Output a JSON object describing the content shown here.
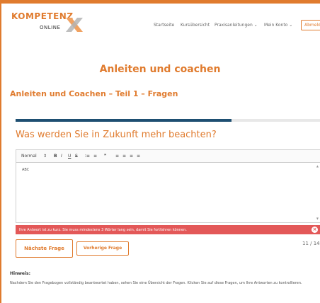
{
  "brand": {
    "name_top": "KOMPETENZ",
    "name_bottom": "ONLINE",
    "icon": "x-mark-logo"
  },
  "nav": {
    "items": [
      {
        "label": "Startseite"
      },
      {
        "label": "Kursübersicht"
      },
      {
        "label": "Praxisanleitungen ⌄"
      },
      {
        "label": "Mein Konto ⌄"
      }
    ],
    "logout_label": "Abmelden"
  },
  "page": {
    "title": "Anleiten und coachen",
    "subtitle": "Anleiten und Coachen – Teil 1 – Fragen"
  },
  "quiz": {
    "progress": 0.71,
    "question": "Was werden Sie in Zukunft mehr beachten?",
    "answer_text": "ABC",
    "counter": "11 / 14"
  },
  "editor_toolbar": {
    "format_select": "Normal",
    "format_arrow": "⇕",
    "bold": "B",
    "italic": "I",
    "underline": "U",
    "strike": "S",
    "ordered_list": "⁝≡",
    "bullet_list": "≡",
    "quote": "❞",
    "align_left": "≡",
    "align_center": "≡",
    "align_right": "≡",
    "align_justify": "≡"
  },
  "error": {
    "message": "Ihre Antwort ist zu kurz. Sie muss mindestens 3 Wörter lang sein, damit Sie fortfahren können.",
    "close_glyph": "×"
  },
  "buttons": {
    "next_label": "Nächste Frage",
    "prev_label": "Vorherige Frage"
  },
  "hint": {
    "label": "Hinweis:",
    "text": "Nachdem Sie den Fragebogen vollständig beantwortet haben, sehen Sie eine Übersicht der Fragen. Klicken Sie auf diese Fragen, um Ihre Antworten zu kontrollieren."
  },
  "colors": {
    "accent": "#e07b2e",
    "progress": "#1e4f72",
    "error": "#e35858"
  }
}
